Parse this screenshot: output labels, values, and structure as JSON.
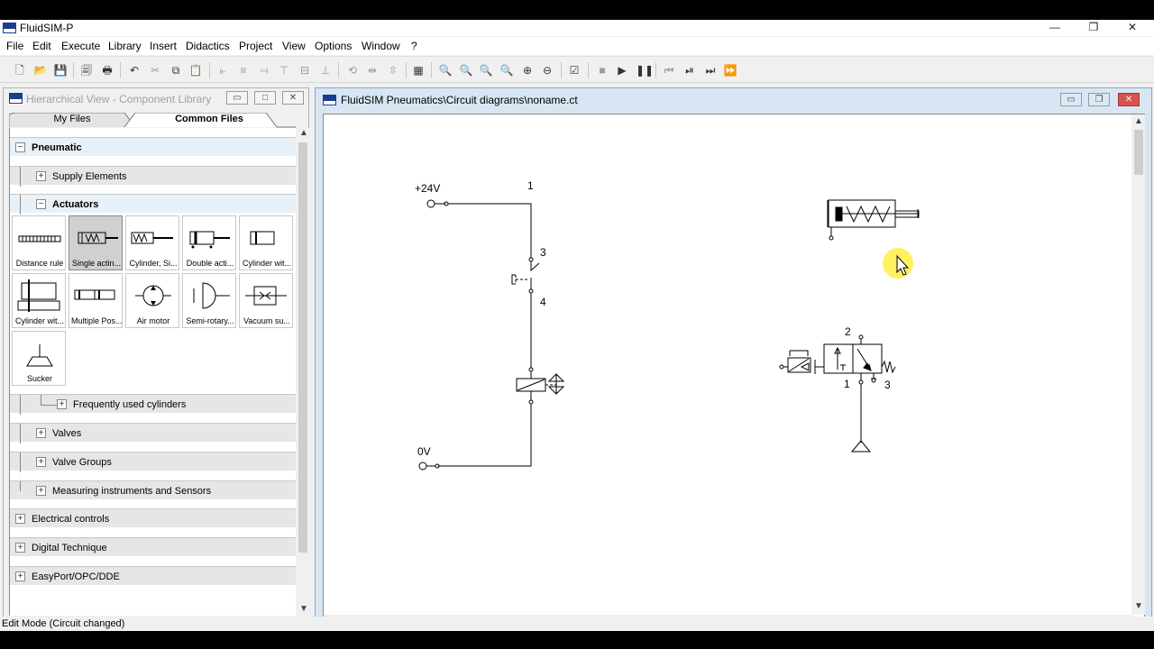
{
  "window": {
    "title": "FluidSIM-P",
    "minimize": "—",
    "restore": "❐",
    "close": "✕"
  },
  "menu": [
    "File",
    "Edit",
    "Execute",
    "Library",
    "Insert",
    "Didactics",
    "Project",
    "View",
    "Options",
    "Window",
    "?"
  ],
  "library_panel": {
    "title": "Hierarchical View - Component Library",
    "tabs": [
      "My Files",
      "Common Files"
    ],
    "groups": {
      "pneumatic": "Pneumatic",
      "supply": "Supply Elements",
      "actuators": "Actuators",
      "freq_cyl": "Frequently used cylinders",
      "valves": "Valves",
      "valve_groups": "Valve Groups",
      "measuring": "Measuring instruments and Sensors",
      "electrical": "Electrical controls",
      "digital": "Digital Technique",
      "easyport": "EasyPort/OPC/DDE"
    },
    "components": [
      "Distance rule",
      "Single actin...",
      "Cylinder, Si...",
      "Double acti...",
      "Cylinder wit...",
      "Cylinder wit...",
      "Multiple Pos...",
      "Air motor",
      "Semi-rotary...",
      "Vacuum su...",
      "Sucker"
    ],
    "selected_component": "Single actin..."
  },
  "circuit_window": {
    "title": "FluidSIM Pneumatics\\Circuit diagrams\\noname.ct",
    "labels": {
      "plus24": "+24V",
      "zero": "0V",
      "n1": "1",
      "n3": "3",
      "n4": "4",
      "v2": "2",
      "v1": "1",
      "v3": "3"
    }
  },
  "status": "Edit Mode (Circuit changed)"
}
